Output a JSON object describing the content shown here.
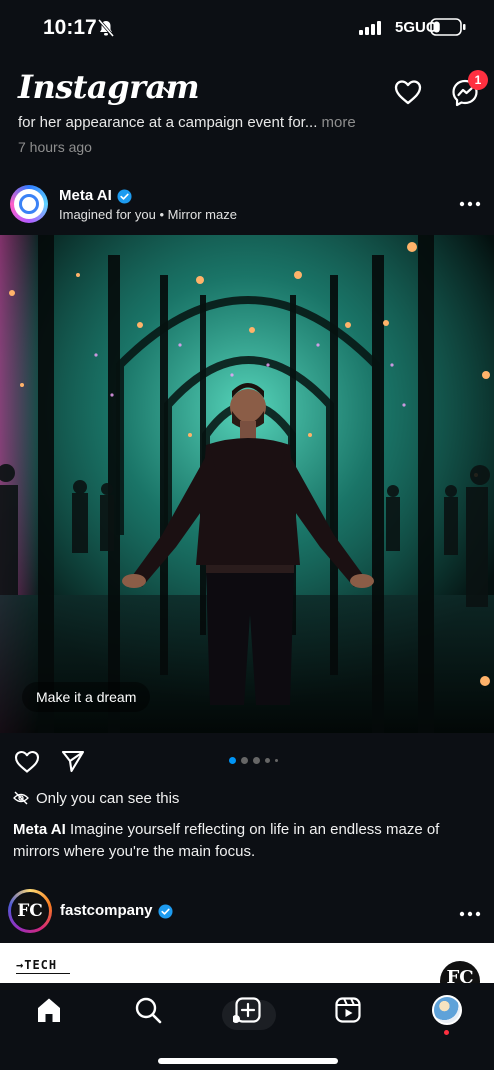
{
  "status_bar": {
    "time": "10:17",
    "network": "5GUC",
    "battery_level": 0.25
  },
  "header": {
    "logo": "Instagram",
    "notification_count": "1"
  },
  "previous_post": {
    "caption": "for her appearance at a campaign event for...",
    "more": "more",
    "time_ago": "7 hours ago"
  },
  "post": {
    "username": "Meta AI",
    "subtitle": "Imagined for you • Mirror maze",
    "image_chip": "Make it a dream",
    "carousel": {
      "count": 5,
      "active_index": 0
    },
    "privacy_note": "Only you can see this",
    "caption_user": "Meta AI",
    "caption_text": " Imagine yourself reflecting on life in an endless maze of mirrors where you're the main focus."
  },
  "next_post": {
    "username": "fastcompany",
    "avatar_text": "FC",
    "card_tag": "→TECH",
    "card_logo": "FC"
  },
  "tabs": [
    {
      "name": "home",
      "icon": "home-icon",
      "active": true
    },
    {
      "name": "search",
      "icon": "search-icon"
    },
    {
      "name": "create",
      "icon": "create-icon"
    },
    {
      "name": "reels",
      "icon": "reels-icon"
    },
    {
      "name": "profile",
      "icon": "profile-avatar"
    }
  ],
  "colors": {
    "background": "#0c0f14",
    "verified": "#1d9bf0",
    "badge": "#ff3040",
    "active_dot": "#0095f6"
  }
}
